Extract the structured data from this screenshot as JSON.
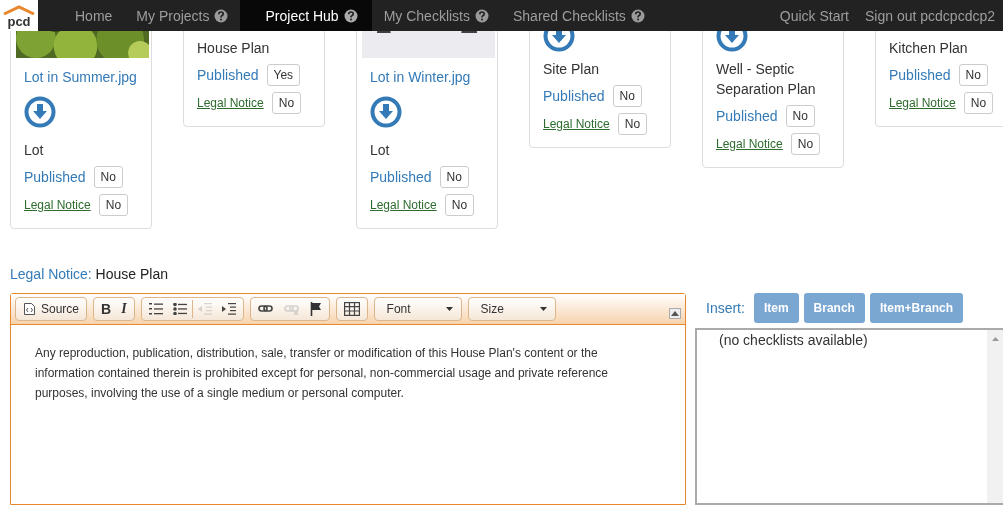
{
  "nav": {
    "logo": "pcd",
    "items": [
      {
        "label": "Home",
        "help": false,
        "selected": false
      },
      {
        "label": "My Projects",
        "help": true,
        "selected": false
      },
      {
        "label": "Project Hub",
        "help": true,
        "selected": true
      },
      {
        "label": "My Checklists",
        "help": true,
        "selected": false
      },
      {
        "label": "Shared Checklists",
        "help": true,
        "selected": false
      }
    ],
    "right": [
      "Quick Start",
      "Sign out pcdcpcdcp2"
    ]
  },
  "cards": [
    {
      "file_name": "Lot in Summer.jpg",
      "title": "Lot",
      "published_label": "Published",
      "published": "No",
      "legal_label": "Legal Notice",
      "legal": "No"
    },
    {
      "kind": "plain",
      "title": "House Plan",
      "published_label": "Published",
      "published": "Yes",
      "legal_label": "Legal Notice",
      "legal": "No"
    },
    {
      "file_name": "Lot in Winter.jpg",
      "title": "Lot",
      "published_label": "Published",
      "published": "No",
      "legal_label": "Legal Notice",
      "legal": "No"
    },
    {
      "kind": "icon",
      "title": "Site Plan",
      "published_label": "Published",
      "published": "No",
      "legal_label": "Legal Notice",
      "legal": "No"
    },
    {
      "kind": "icon",
      "title": "Well - Septic Separation Plan",
      "published_label": "Published",
      "published": "No",
      "legal_label": "Legal Notice",
      "legal": "No"
    },
    {
      "kind": "plain",
      "title": "Kitchen Plan",
      "published_label": "Published",
      "published": "No",
      "legal_label": "Legal Notice",
      "legal": "No"
    }
  ],
  "legal_notice": {
    "label": "Legal Notice:",
    "value": "House Plan"
  },
  "editor": {
    "toolbar": [
      [
        {
          "kind": "source",
          "label": "Source",
          "disabled": false
        }
      ],
      [
        {
          "kind": "bold",
          "label": "B",
          "disabled": false
        },
        {
          "kind": "italic",
          "label": "I",
          "disabled": false
        }
      ],
      [
        {
          "kind": "numbered",
          "disabled": false
        },
        {
          "kind": "bulleted",
          "disabled": false
        },
        {
          "kind": "outdent",
          "disabled": true
        },
        {
          "kind": "indent",
          "disabled": false
        }
      ],
      [
        {
          "kind": "link",
          "disabled": false
        },
        {
          "kind": "unlink",
          "disabled": true
        },
        {
          "kind": "anchor",
          "disabled": false
        }
      ],
      [
        {
          "kind": "table",
          "disabled": false
        }
      ],
      [
        {
          "kind": "dropdown",
          "label": "Font",
          "disabled": false
        }
      ],
      [
        {
          "kind": "dropdown",
          "label": "Size",
          "disabled": false
        }
      ]
    ],
    "content": "Any reproduction, publication, distribution, sale, transfer or modification of this House Plan's content or the information contained therein is prohibited except for personal, non-commercial usage and private reference purposes, involving the use of a single medium or personal computer."
  },
  "insert": {
    "label": "Insert:",
    "buttons": [
      "Item",
      "Branch",
      "Item+Branch"
    ],
    "placeholder_text": "(no checklists available)"
  }
}
